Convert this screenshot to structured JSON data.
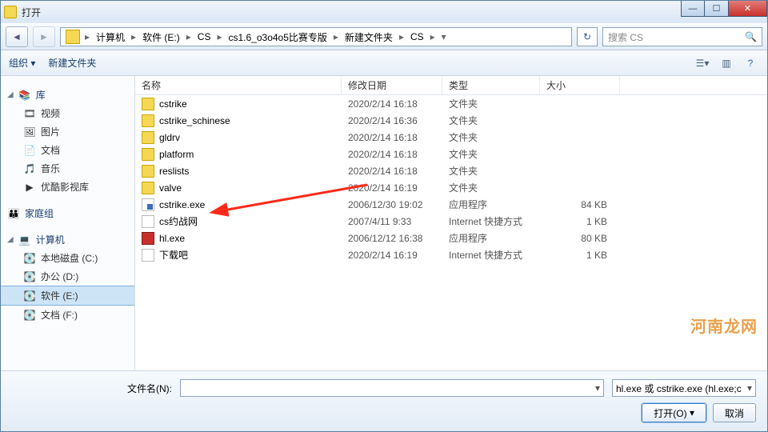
{
  "title": "打开",
  "breadcrumb": [
    "计算机",
    "软件 (E:)",
    "CS",
    "cs1.6_o3o4o5比赛专版",
    "新建文件夹",
    "CS"
  ],
  "search_placeholder": "搜索 CS",
  "toolbar": {
    "organize": "组织 ▾",
    "newfolder": "新建文件夹"
  },
  "columns": {
    "name": "名称",
    "date": "修改日期",
    "type": "类型",
    "size": "大小"
  },
  "sidebar": {
    "libraries": {
      "label": "库",
      "items": [
        "视频",
        "图片",
        "文档",
        "音乐",
        "优酷影视库"
      ]
    },
    "homegroup": {
      "label": "家庭组"
    },
    "computer": {
      "label": "计算机",
      "items": [
        "本地磁盘 (C:)",
        "办公 (D:)",
        "软件 (E:)",
        "文档 (F:)"
      ],
      "selected": 2
    }
  },
  "files": [
    {
      "name": "cstrike",
      "date": "2020/2/14 16:18",
      "type": "文件夹",
      "size": "",
      "icon": "folder"
    },
    {
      "name": "cstrike_schinese",
      "date": "2020/2/14 16:36",
      "type": "文件夹",
      "size": "",
      "icon": "folder"
    },
    {
      "name": "gldrv",
      "date": "2020/2/14 16:18",
      "type": "文件夹",
      "size": "",
      "icon": "folder"
    },
    {
      "name": "platform",
      "date": "2020/2/14 16:18",
      "type": "文件夹",
      "size": "",
      "icon": "folder"
    },
    {
      "name": "reslists",
      "date": "2020/2/14 16:18",
      "type": "文件夹",
      "size": "",
      "icon": "folder"
    },
    {
      "name": "valve",
      "date": "2020/2/14 16:19",
      "type": "文件夹",
      "size": "",
      "icon": "folder"
    },
    {
      "name": "cstrike.exe",
      "date": "2006/12/30 19:02",
      "type": "应用程序",
      "size": "84 KB",
      "icon": "exe"
    },
    {
      "name": "cs约战网",
      "date": "2007/4/11 9:33",
      "type": "Internet 快捷方式",
      "size": "1 KB",
      "icon": "url"
    },
    {
      "name": "hl.exe",
      "date": "2006/12/12 16:38",
      "type": "应用程序",
      "size": "80 KB",
      "icon": "hl"
    },
    {
      "name": "下载吧",
      "date": "2020/2/14 16:19",
      "type": "Internet 快捷方式",
      "size": "1 KB",
      "icon": "url"
    }
  ],
  "filename_label": "文件名(N):",
  "filetype": "hl.exe 或 cstrike.exe (hl.exe;c",
  "open_btn": "打开(O)",
  "cancel_btn": "取消",
  "watermark": "河南龙网"
}
